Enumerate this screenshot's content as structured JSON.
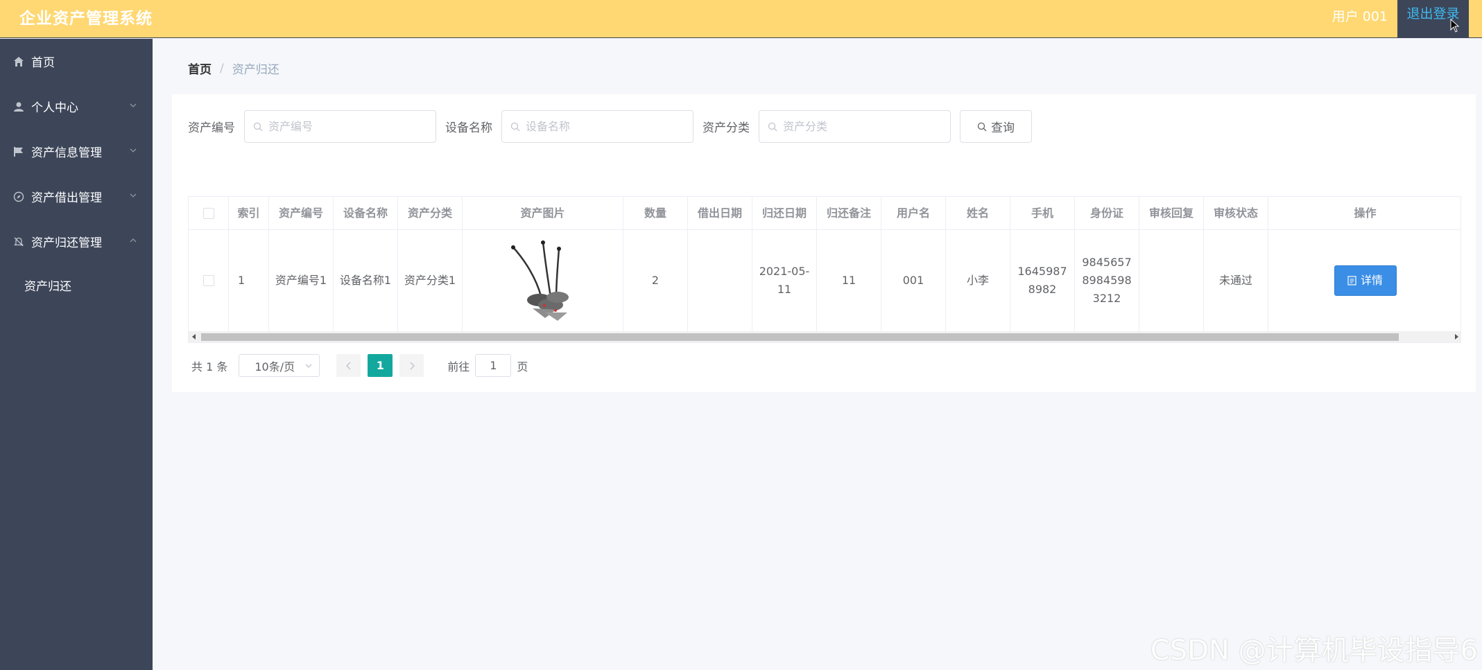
{
  "header": {
    "title": "企业资产管理系统",
    "user": "用户 001",
    "logout": "退出登录"
  },
  "sidebar": {
    "items": [
      {
        "label": "首页",
        "icon": "home-icon"
      },
      {
        "label": "个人中心",
        "icon": "user-icon"
      },
      {
        "label": "资产信息管理",
        "icon": "flag-icon"
      },
      {
        "label": "资产借出管理",
        "icon": "compass-icon"
      },
      {
        "label": "资产归还管理",
        "icon": "bell-off-icon"
      }
    ],
    "subitems": [
      {
        "label": "资产归还"
      }
    ]
  },
  "breadcrumb": {
    "home": "首页",
    "separator": "/",
    "current": "资产归还"
  },
  "search": {
    "asset_no_label": "资产编号",
    "asset_no_placeholder": "资产编号",
    "device_name_label": "设备名称",
    "device_name_placeholder": "设备名称",
    "category_label": "资产分类",
    "category_placeholder": "资产分类",
    "query_button": "查询"
  },
  "table": {
    "headers": [
      "索引",
      "资产编号",
      "设备名称",
      "资产分类",
      "资产图片",
      "数量",
      "借出日期",
      "归还日期",
      "归还备注",
      "用户名",
      "姓名",
      "手机",
      "身份证",
      "审核回复",
      "审核状态",
      "操作"
    ],
    "rows": [
      {
        "index": "1",
        "asset_no": "资产编号1",
        "device_name": "设备名称1",
        "category": "资产分类1",
        "image": "conference-microphone-image",
        "quantity": "2",
        "lend_date": "",
        "return_date": "2021-05-11",
        "return_note": "11",
        "username": "001",
        "name": "小李",
        "phone": "16459878982",
        "id_card": "984565789845983212",
        "review_reply": "",
        "review_status": "未通过",
        "action": "详情"
      }
    ]
  },
  "pagination": {
    "total": "共 1 条",
    "page_size": "10条/页",
    "current_page": "1",
    "goto_label": "前往",
    "goto_value": "1",
    "page_suffix": "页"
  },
  "watermark": "CSDN @计算机毕设指导6",
  "colors": {
    "header_bg": "#ffd873",
    "sidebar_bg": "#3d4659",
    "logout_text": "#3fb9f0",
    "detail_button": "#3a8ee6",
    "active_page": "#13a89e"
  }
}
